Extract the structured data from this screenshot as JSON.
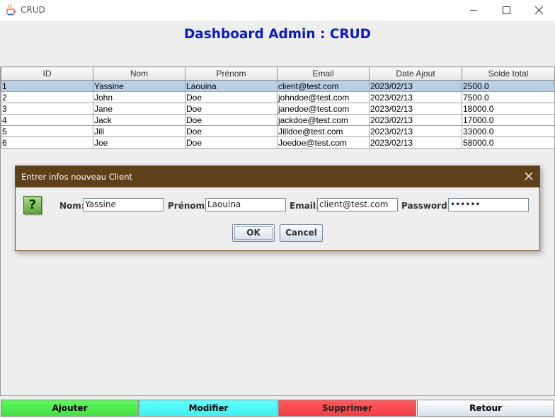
{
  "window": {
    "title": "CRUD"
  },
  "heading": "Dashboard Admin : CRUD",
  "table": {
    "columns": [
      "ID",
      "Nom",
      "Prénom",
      "Email",
      "Date Ajout",
      "Solde total"
    ],
    "rows": [
      [
        "1",
        "Yassine",
        "Laouina",
        "client@test.com",
        "2023/02/13",
        "2500.0"
      ],
      [
        "2",
        "John",
        "Doe",
        "johndoe@test.com",
        "2023/02/13",
        "7500.0"
      ],
      [
        "3",
        "Jane",
        "Doe",
        "janedoe@test.com",
        "2023/02/13",
        "18000.0"
      ],
      [
        "4",
        "Jack",
        "Doe",
        "jackdoe@test.com",
        "2023/02/13",
        "17000.0"
      ],
      [
        "5",
        "Jill",
        "Doe",
        "Jilldoe@test.com",
        "2023/02/13",
        "33000.0"
      ],
      [
        "6",
        "Joe",
        "Doe",
        "Joedoe@test.com",
        "2023/02/13",
        "58000.0"
      ]
    ],
    "selected_row": 0
  },
  "dialog": {
    "title": "Entrer infos nouveau Client",
    "icon": "question-icon",
    "icon_glyph": "?",
    "fields": {
      "nom_label": "Nom:",
      "nom_value": "Yassine",
      "prenom_label": "Prénom:",
      "prenom_value": "Laouina",
      "email_label": "Email:",
      "email_value": "client@test.com",
      "password_label": "Password:",
      "password_value": "••••••"
    },
    "ok_label": "OK",
    "cancel_label": "Cancel"
  },
  "buttons": {
    "ajouter": {
      "label": "Ajouter",
      "color": "#4cf04c"
    },
    "modifier": {
      "label": "Modifier",
      "color": "#4cf8f8"
    },
    "supprimer": {
      "label": "Supprimer",
      "color": "#f8464c"
    },
    "retour": {
      "label": "Retour",
      "color": "#e8eef6"
    }
  },
  "colors": {
    "heading": "#0a19c8",
    "dialog_title_bg": "#5e411a",
    "selection": "#b8cfe5"
  }
}
